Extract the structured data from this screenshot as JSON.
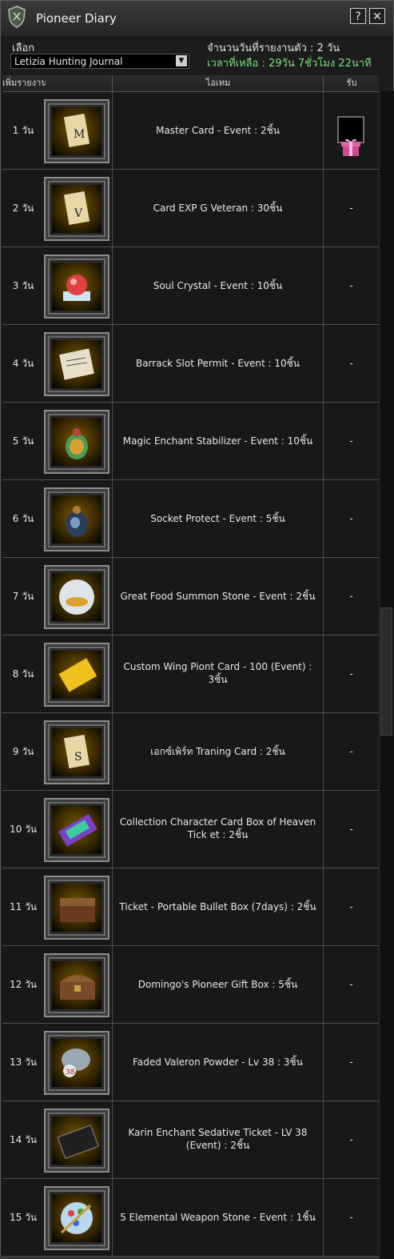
{
  "window": {
    "title": "Pioneer Diary",
    "help": "?",
    "close": "✕"
  },
  "filter": {
    "select_label": "เลือก",
    "selected": "Letizia Hunting Journal",
    "days_reported": "จำนวนวันที่รายงานตัว : 2 วัน",
    "time_left": "เวลาที่เหลือ : 29วัน 7ชั่วโมง 22นาที"
  },
  "table": {
    "headers": {
      "day": "เพิ่มรายงานตัว",
      "item": "ไอเทม",
      "receive": "รับ"
    },
    "rows": [
      {
        "day": "1 วัน",
        "item": "Master Card - Event : 2ชิ้น",
        "receive": "gift",
        "icon": "master-card-icon"
      },
      {
        "day": "2 วัน",
        "item": "Card EXP G Veteran : 30ชิ้น",
        "receive": "-",
        "icon": "card-exp-icon"
      },
      {
        "day": "3 วัน",
        "item": "Soul Crystal - Event : 10ชิ้น",
        "receive": "-",
        "icon": "soul-crystal-icon"
      },
      {
        "day": "4 วัน",
        "item": "Barrack Slot Permit - Event : 10ชิ้น",
        "receive": "-",
        "icon": "permit-scroll-icon"
      },
      {
        "day": "5 วัน",
        "item": "Magic Enchant Stabilizer - Event : 10ชิ้น",
        "receive": "-",
        "icon": "stabilizer-pouch-icon"
      },
      {
        "day": "6 วัน",
        "item": "Socket Protect - Event : 5ชิ้น",
        "receive": "-",
        "icon": "socket-pouch-icon"
      },
      {
        "day": "7 วัน",
        "item": "Great Food Summon Stone - Event : 2ชิ้น",
        "receive": "-",
        "icon": "food-orb-icon"
      },
      {
        "day": "8 วัน",
        "item": "Custom Wing Piont Card - 100 (Event) : 3ชิ้น",
        "receive": "-",
        "icon": "wing-card-icon"
      },
      {
        "day": "9 วัน",
        "item": "เอกซ์เพิร์ท Traning Card : 2ชิ้น",
        "receive": "-",
        "icon": "training-card-icon"
      },
      {
        "day": "10 วัน",
        "item": "Collection Character Card Box of Heaven Tick et : 2ชิ้น",
        "receive": "-",
        "icon": "rainbow-ticket-icon"
      },
      {
        "day": "11 วัน",
        "item": "Ticket - Portable Bullet Box (7days) : 2ชิ้น",
        "receive": "-",
        "icon": "bullet-box-icon"
      },
      {
        "day": "12 วัน",
        "item": "Domingo's Pioneer Gift Box : 5ชิ้น",
        "receive": "-",
        "icon": "treasure-chest-icon"
      },
      {
        "day": "13 วัน",
        "item": "Faded Valeron Powder - Lv 38 : 3ชิ้น",
        "receive": "-",
        "icon": "powder-bag-icon"
      },
      {
        "day": "14 วัน",
        "item": "Karin Enchant Sedative Ticket - LV 38 (Event) : 2ชิ้น",
        "receive": "-",
        "icon": "black-ticket-icon"
      },
      {
        "day": "15 วัน",
        "item": "5 Elemental Weapon Stone - Event : 1ชิ้น",
        "receive": "-",
        "icon": "elemental-orb-icon"
      }
    ]
  }
}
